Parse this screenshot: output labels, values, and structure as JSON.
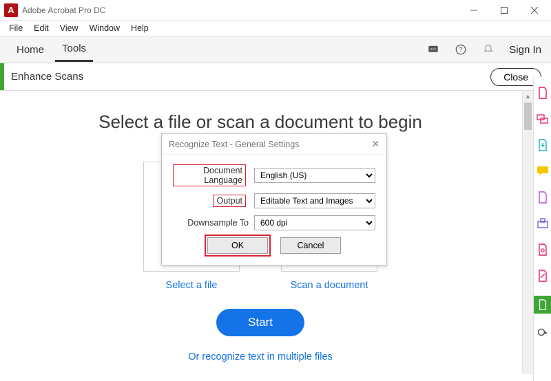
{
  "window": {
    "title": "Adobe Acrobat Pro DC"
  },
  "menu": {
    "file": "File",
    "edit": "Edit",
    "view": "View",
    "window": "Window",
    "help": "Help"
  },
  "tabs": {
    "home": "Home",
    "tools": "Tools",
    "signin": "Sign In"
  },
  "toolbar": {
    "name": "Enhance Scans",
    "close": "Close"
  },
  "main": {
    "headline": "Select a file or scan a document to begin",
    "select_file": "Select a file",
    "scan_doc": "Scan a document",
    "start": "Start",
    "multi": "Or recognize text in multiple files"
  },
  "dialog": {
    "title": "Recognize Text - General Settings",
    "lang_label": "Document Language",
    "lang_value": "English (US)",
    "output_label": "Output",
    "output_value": "Editable Text and Images",
    "down_label": "Downsample To",
    "down_value": "600 dpi",
    "ok": "OK",
    "cancel": "Cancel"
  }
}
